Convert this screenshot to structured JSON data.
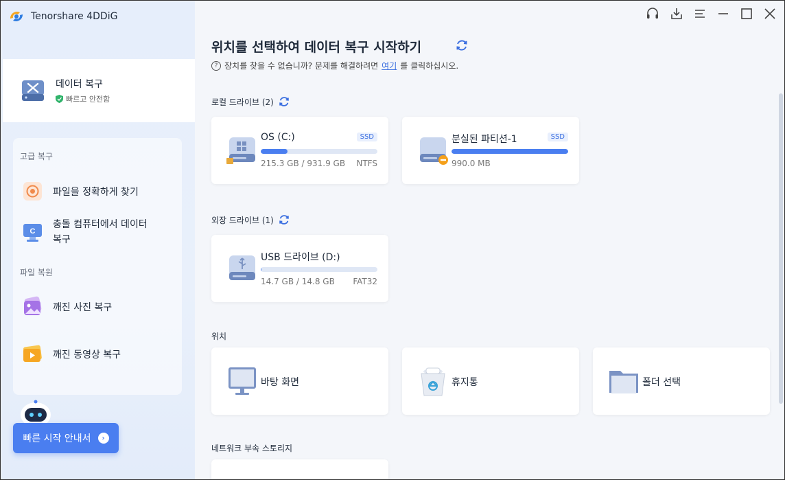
{
  "app": {
    "title": "Tenorshare 4DDiG"
  },
  "titlebar": {
    "icons": [
      "headset-icon",
      "download-icon",
      "menu-icon",
      "minimize-icon",
      "maximize-icon",
      "close-icon"
    ]
  },
  "sidebar": {
    "active": {
      "title": "데이터 복구",
      "subtitle": "빠르고 안전함"
    },
    "sections": [
      {
        "label": "고급 복구",
        "items": [
          {
            "label": "파일을 정확하게 찾기"
          },
          {
            "label_line1": "충돌 컴퓨터에서 데이터",
            "label_line2": "복구"
          }
        ]
      },
      {
        "label": "파일 복원",
        "items": [
          {
            "label": "깨진 사진 복구"
          },
          {
            "label": "깨진 동영상 복구"
          }
        ]
      }
    ],
    "quick_start": "빠른 시작 안내서"
  },
  "main": {
    "title": "위치를 선택하여 데이터 복구 시작하기",
    "help_prefix": "장치를 찾을 수 없습니까? 문제를 해결하려면 ",
    "help_link": "여기",
    "help_suffix": "를 클릭하십시오.",
    "local": {
      "label": "로컬 드라이브 (2)",
      "drives": [
        {
          "name": "OS (C:)",
          "tag": "SSD",
          "size": "215.3 GB / 931.9 GB",
          "fs": "NTFS",
          "used_fraction": 0.231
        },
        {
          "name": "분실된 파티션-1",
          "tag": "SSD",
          "size": "990.0 MB",
          "fs": "",
          "used_fraction": 1.0
        }
      ]
    },
    "external": {
      "label": "외장 드라이브 (1)",
      "drives": [
        {
          "name": "USB 드라이브 (D:)",
          "size": "14.7 GB / 14.8 GB",
          "fs": "FAT32",
          "used_fraction": 0.007
        }
      ]
    },
    "locations": {
      "label": "위치",
      "items": [
        {
          "name": "바탕 화면"
        },
        {
          "name": "휴지통"
        },
        {
          "name": "폴더 선택"
        }
      ]
    },
    "nas": {
      "label": "네트워크 부속 스토리지"
    }
  },
  "colors": {
    "accent": "#4a7ef0",
    "link": "#3b6fe0",
    "sidebar_bg": "#e6eefb",
    "main_bg": "#f4f6fa"
  }
}
